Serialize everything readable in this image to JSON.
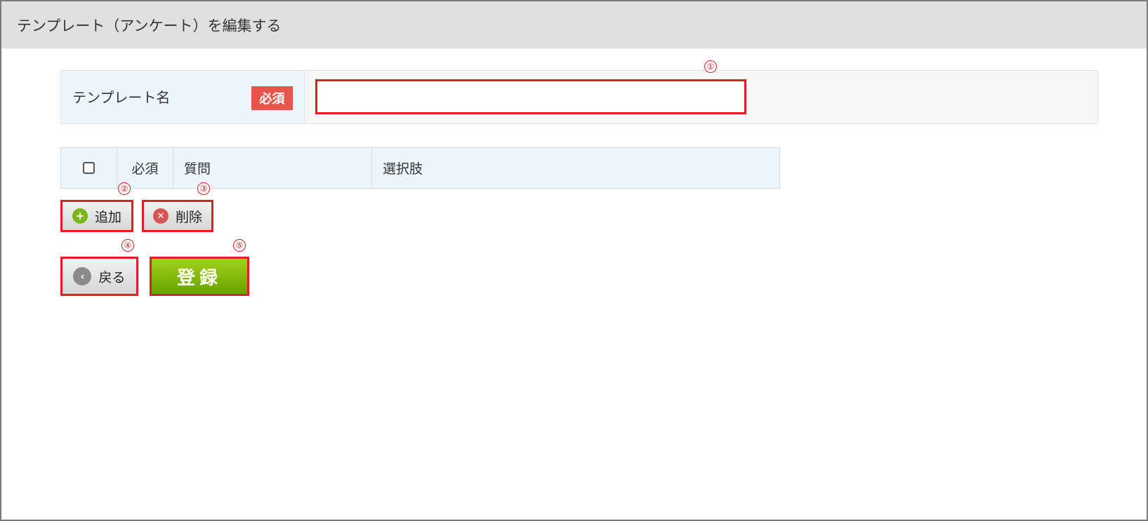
{
  "header": {
    "title": "テンプレート（アンケート）を編集する"
  },
  "template_name": {
    "label": "テンプレート名",
    "required_badge": "必須",
    "input_value": "",
    "input_placeholder": ""
  },
  "question_table": {
    "columns": [
      "",
      "必須",
      "質問",
      "選択肢"
    ]
  },
  "buttons": {
    "add": "追加",
    "delete": "削除",
    "back": "戻る",
    "submit": "登録"
  },
  "callouts": [
    "①",
    "②",
    "③",
    "④",
    "⑤"
  ],
  "colors": {
    "accent_red": "#e02020",
    "required_badge": "#e8554b",
    "submit_green": "#7ab800",
    "header_bg": "#e0e0e0",
    "label_bg": "#eef6fd"
  }
}
